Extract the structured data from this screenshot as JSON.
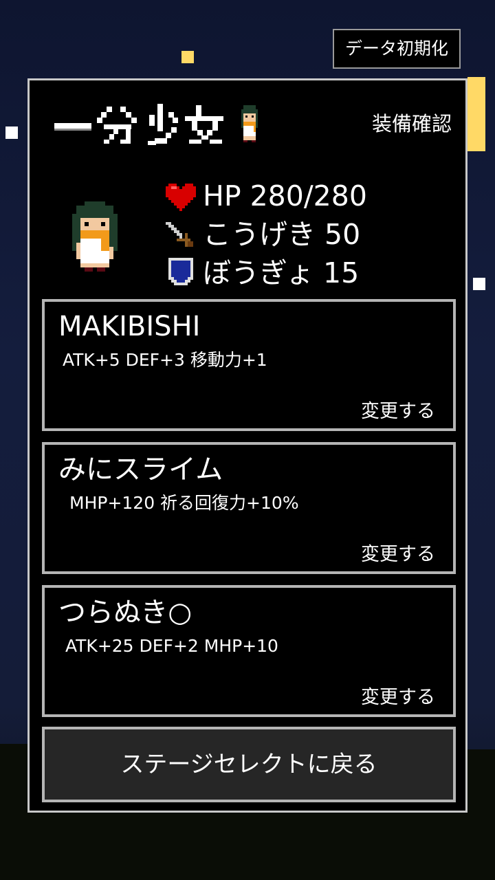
{
  "header": {
    "reset_label": "データ初期化"
  },
  "panel": {
    "logo_text": "一分少女",
    "title_label": "装備確認"
  },
  "stats": {
    "hp": "HP 280/280",
    "attack": "こうげき 50",
    "defense": "ぼうぎょ 15",
    "icons": [
      "heart-icon",
      "sword-icon",
      "shield-icon"
    ],
    "colors": {
      "heart": "#d80000",
      "shield": "#1a2a9a"
    }
  },
  "equipment": [
    {
      "name": "MAKIBISHI",
      "desc": "ATK+5 DEF+3 移動力+1",
      "change_label": "変更する"
    },
    {
      "name": "みにスライム",
      "desc": "MHP+120 祈る回復力+10%",
      "change_label": "変更する"
    },
    {
      "name": "つらぬき○",
      "desc": "ATK+25 DEF+2 MHP+10",
      "change_label": "変更する"
    }
  ],
  "back_button": {
    "label": "ステージセレクトに戻る"
  }
}
